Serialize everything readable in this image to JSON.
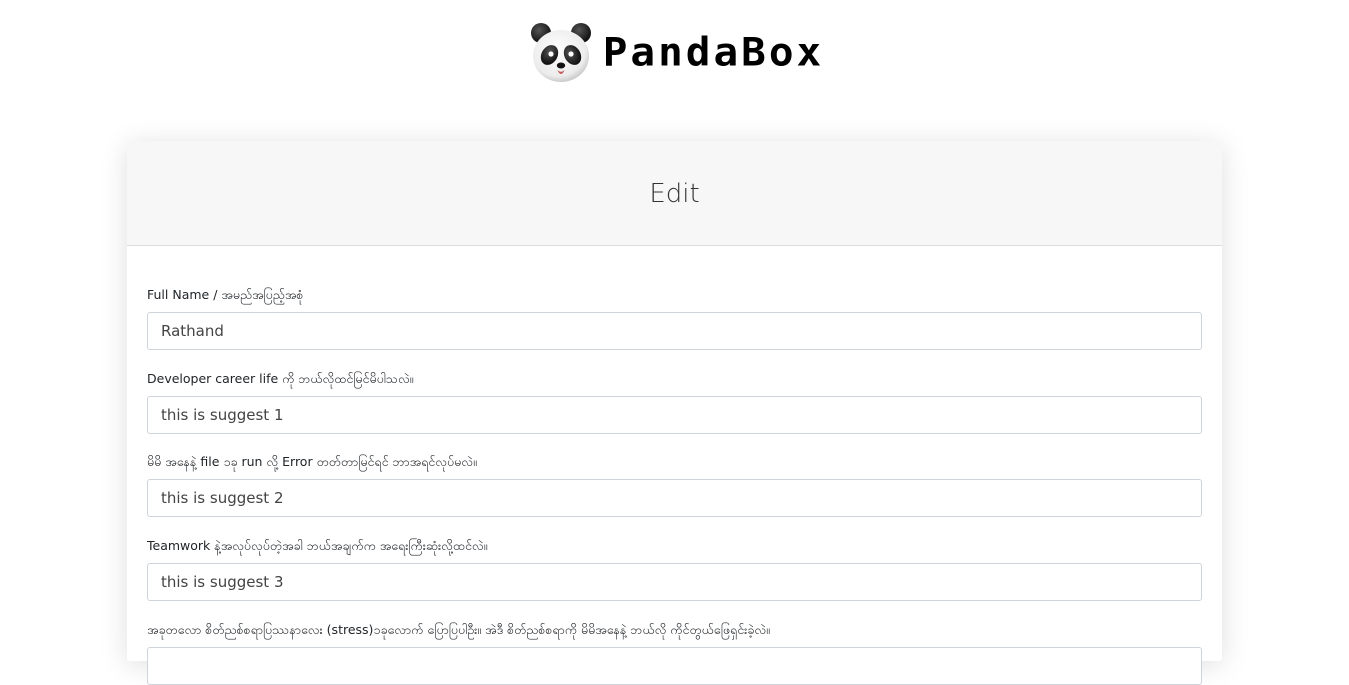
{
  "brand": {
    "name": "PandaBox",
    "logo_icon": "panda-face-icon"
  },
  "form": {
    "title": "Edit",
    "fields": [
      {
        "label": "Full Name / အမည်အပြည့်အစုံ",
        "value": "Rathand"
      },
      {
        "label": "Developer career life ကို ဘယ်လိုထင်မြင်မိပါသလဲ။",
        "value": "this is suggest 1"
      },
      {
        "label": "မိမိ အနေနဲ့ file ၁ခု run လို့ Error တတ်တာမြင်ရင် ဘာအရင်လုပ်မလဲ။",
        "value": "this is suggest 2"
      },
      {
        "label": "Teamwork နဲ့အလုပ်လုပ်တဲ့အခါ ဘယ်အချက်က အရေးကြီးဆုံးလို့ထင်လဲ။",
        "value": "this is suggest 3"
      },
      {
        "label": "အခုတလော စိတ်ညစ်စရာပြဿနာလေး (stress)၁ခုလောက် ပြောပြပါဦး။ အဲဒီ စိတ်ညစ်စရာကို မိမိအနေနဲ့ ဘယ်လို ကိုင်တွယ်ဖြေရှင်းခဲ့လဲ။",
        "value": ""
      }
    ]
  }
}
